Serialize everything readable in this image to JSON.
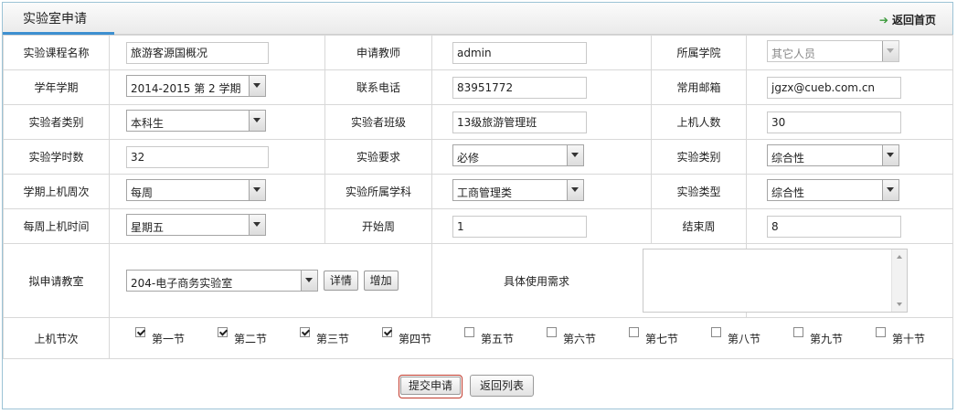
{
  "header": {
    "title": "实验室申请",
    "back_home": "返回首页"
  },
  "rows": {
    "course_name": {
      "label": "实验课程名称",
      "value": "旅游客源国概况"
    },
    "teacher": {
      "label": "申请教师",
      "value": "admin"
    },
    "college": {
      "label": "所属学院",
      "value": "其它人员"
    },
    "term": {
      "label": "学年学期",
      "value": "2014-2015 第 2 学期"
    },
    "phone": {
      "label": "联系电话",
      "value": "83951772"
    },
    "email": {
      "label": "常用邮箱",
      "value": "jgzx@cueb.com.cn"
    },
    "student_type": {
      "label": "实验者类别",
      "value": "本科生"
    },
    "student_class": {
      "label": "实验者班级",
      "value": "13级旅游管理班"
    },
    "machine_count": {
      "label": "上机人数",
      "value": "30"
    },
    "hours": {
      "label": "实验学时数",
      "value": "32"
    },
    "requirement": {
      "label": "实验要求",
      "value": "必修"
    },
    "lab_category": {
      "label": "实验类别",
      "value": "综合性"
    },
    "weekly_freq": {
      "label": "学期上机周次",
      "value": "每周"
    },
    "subject": {
      "label": "实验所属学科",
      "value": "工商管理类"
    },
    "lab_type": {
      "label": "实验类型",
      "value": "综合性"
    },
    "weekday": {
      "label": "每周上机时间",
      "value": "星期五"
    },
    "start_week": {
      "label": "开始周",
      "value": "1"
    },
    "end_week": {
      "label": "结束周",
      "value": "8"
    },
    "classroom": {
      "label": "拟申请教室",
      "value": "204-电子商务实验室",
      "detail": "详情",
      "add": "增加"
    },
    "usage": {
      "label": "具体使用需求",
      "value": ""
    },
    "periods": {
      "label": "上机节次",
      "items": [
        {
          "label": "第一节",
          "checked": true
        },
        {
          "label": "第二节",
          "checked": true
        },
        {
          "label": "第三节",
          "checked": true
        },
        {
          "label": "第四节",
          "checked": true
        },
        {
          "label": "第五节",
          "checked": false
        },
        {
          "label": "第六节",
          "checked": false
        },
        {
          "label": "第七节",
          "checked": false
        },
        {
          "label": "第八节",
          "checked": false
        },
        {
          "label": "第九节",
          "checked": false
        },
        {
          "label": "第十节",
          "checked": false
        }
      ]
    }
  },
  "actions": {
    "submit": "提交申请",
    "back_list": "返回列表"
  }
}
